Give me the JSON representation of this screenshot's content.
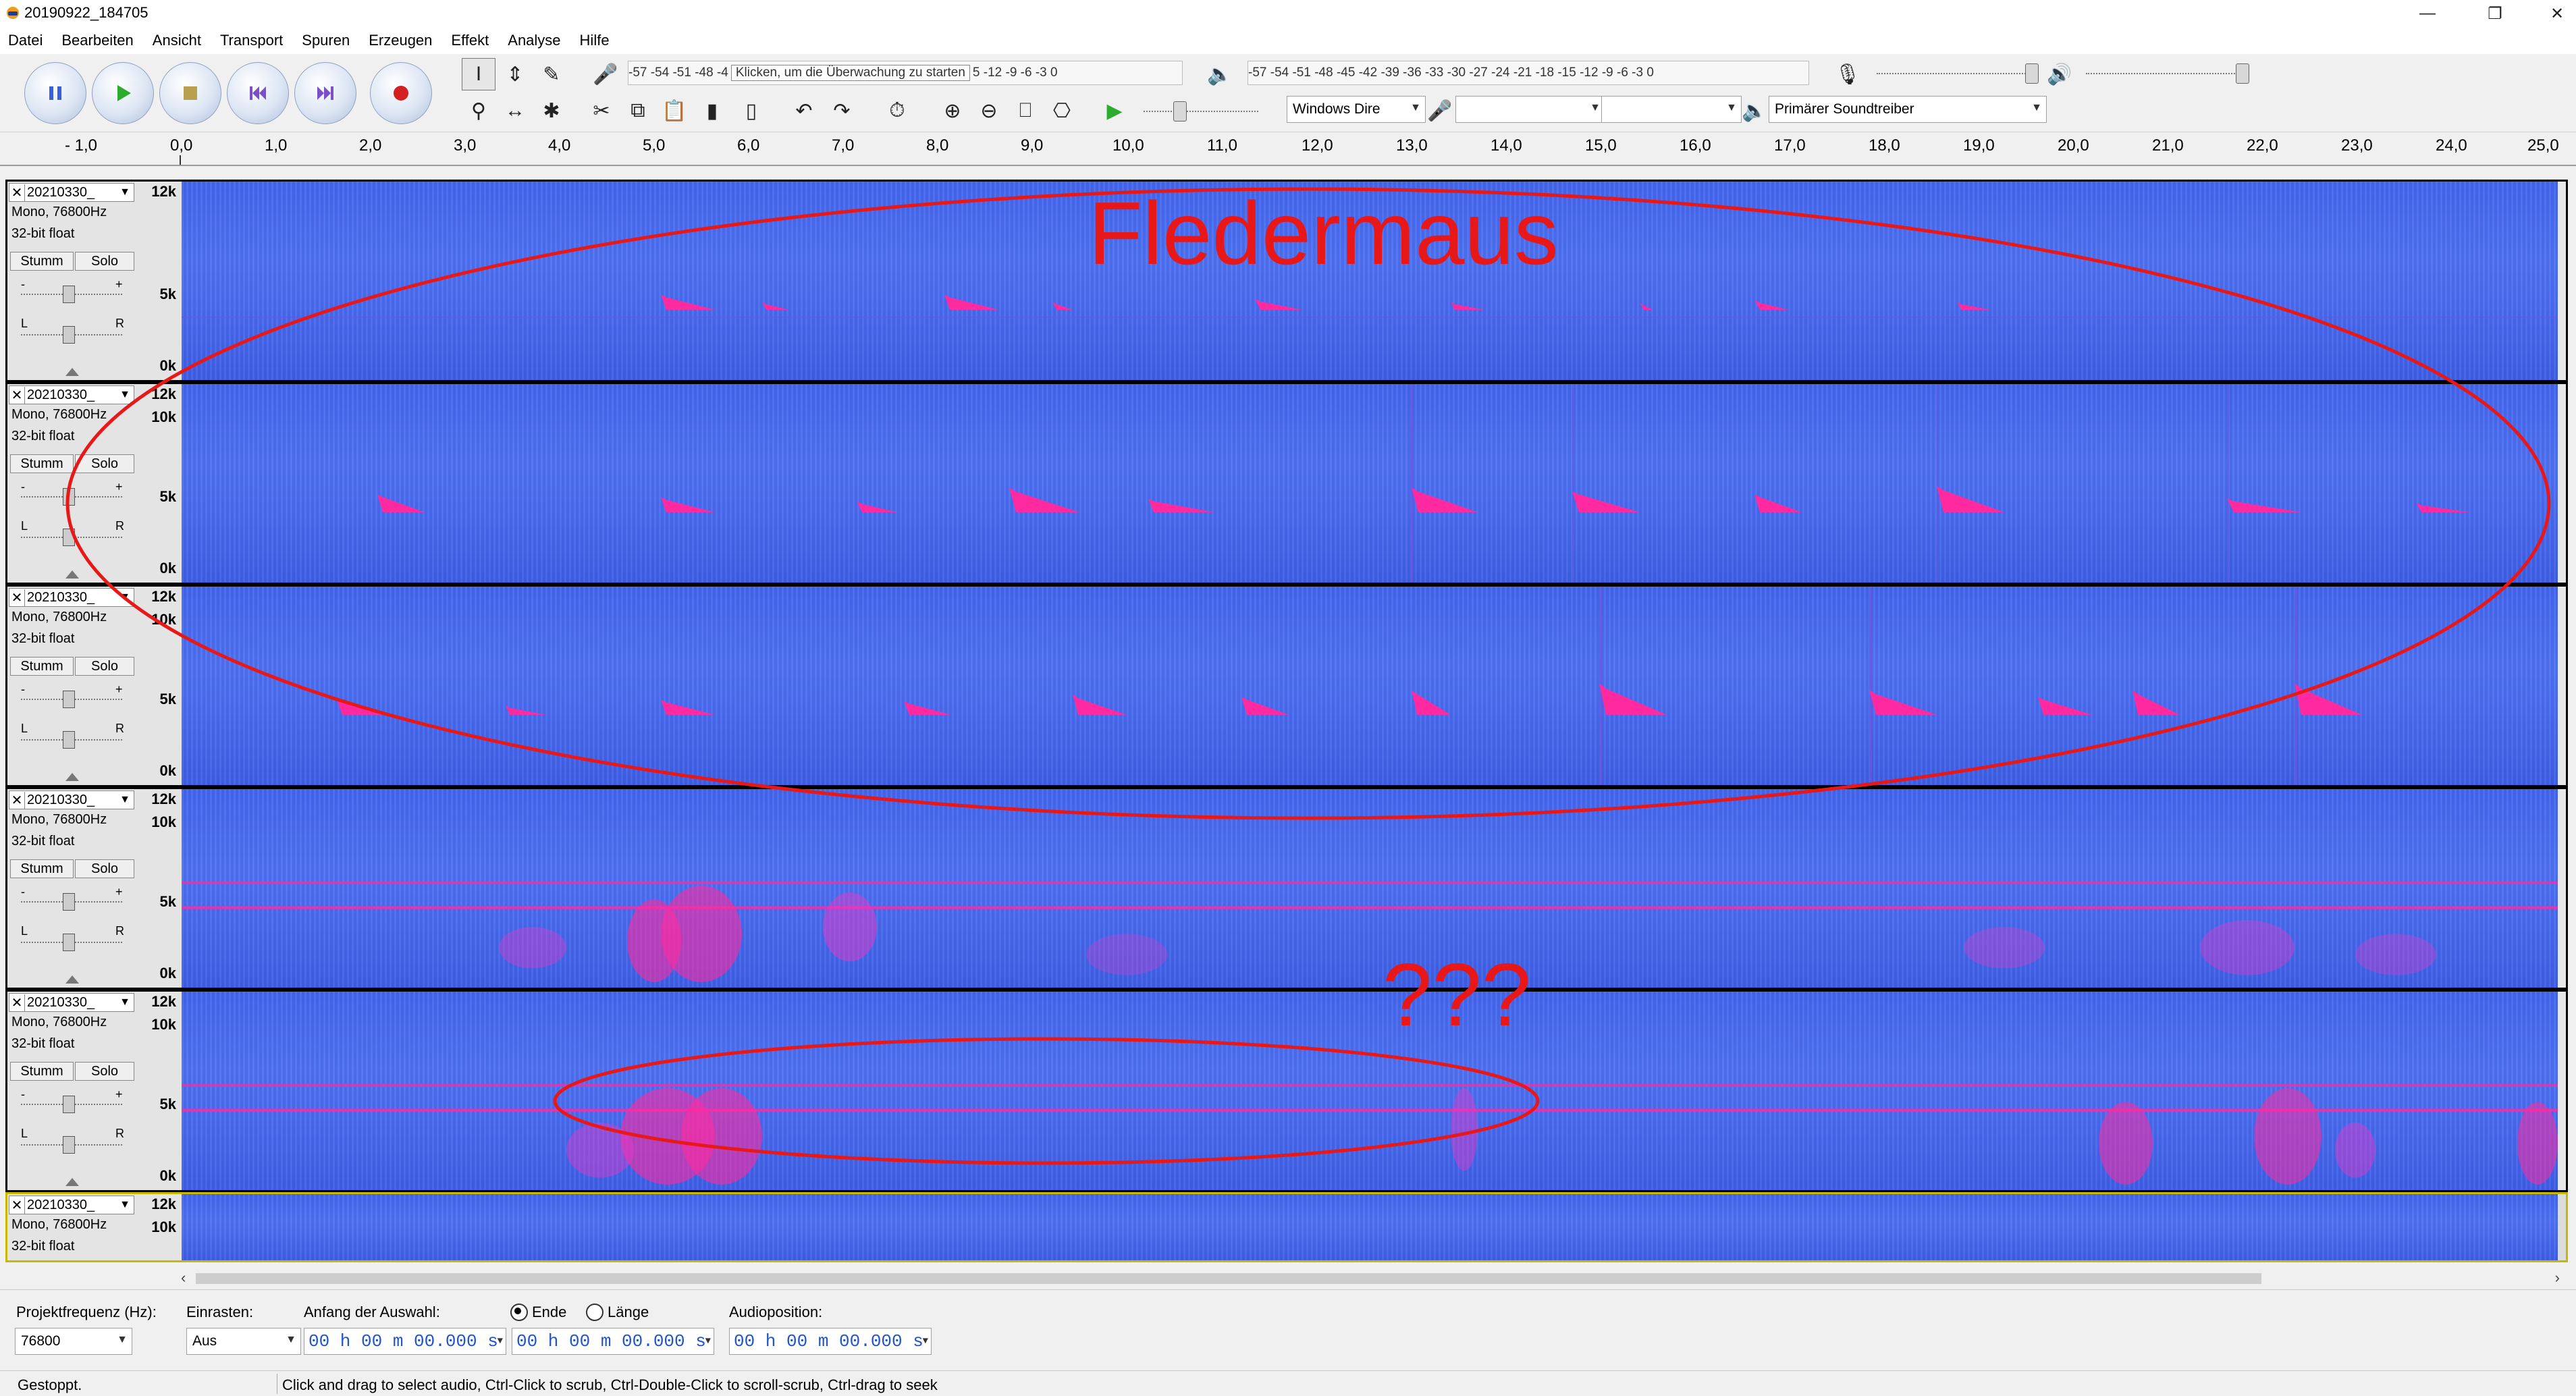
{
  "window": {
    "title": "20190922_184705"
  },
  "menu": [
    "Datei",
    "Bearbeiten",
    "Ansicht",
    "Transport",
    "Spuren",
    "Erzeugen",
    "Effekt",
    "Analyse",
    "Hilfe"
  ],
  "meters": {
    "record_scale": "-57 -54 -51 -48 -4",
    "monitor_hint": "Klicken, um die Überwachung zu starten",
    "record_scale_tail": "5 -12 -9 -6 -3 0",
    "playback_scale": "-57 -54 -51 -48 -45 -42 -39 -36 -33 -30 -27 -24 -21 -18 -15 -12 -9 -6 -3 0"
  },
  "devices": {
    "host": "Windows Dire",
    "recording_device": "",
    "channels": "",
    "playback_device": "Primärer Soundtreiber"
  },
  "ruler": {
    "ticks": [
      "- 1,0",
      "0,0",
      "1,0",
      "2,0",
      "3,0",
      "4,0",
      "5,0",
      "6,0",
      "7,0",
      "8,0",
      "9,0",
      "10,0",
      "11,0",
      "12,0",
      "13,0",
      "14,0",
      "15,0",
      "16,0",
      "17,0",
      "18,0",
      "19,0",
      "20,0",
      "21,0",
      "22,0",
      "23,0",
      "24,0",
      "25,0"
    ]
  },
  "track_common": {
    "name": "20210330_",
    "format": "Mono, 76800Hz",
    "bitdepth": "32-bit float",
    "mute_label": "Stumm",
    "solo_label": "Solo",
    "pan_left": "L",
    "pan_right": "R",
    "gain_minus": "-",
    "gain_plus": "+"
  },
  "freq_scale": {
    "top": "12k",
    "upper": "10k",
    "mid": "5k",
    "bottom": "0k"
  },
  "annotations": {
    "bat_label": "Fledermaus",
    "unknown_label": "???"
  },
  "selection_toolbar": {
    "rate_label": "Projektfrequenz (Hz):",
    "rate_value": "76800",
    "snap_label": "Einrasten:",
    "snap_value": "Aus",
    "start_label": "Anfang der Auswahl:",
    "end_radio": "Ende",
    "length_radio": "Länge",
    "start_time": "00 h 00 m 00.000 s",
    "end_time": "00 h 00 m 00.000 s",
    "audio_pos_label": "Audioposition:",
    "audio_pos_time": "00 h 00 m 00.000 s"
  },
  "status": {
    "state": "Gestoppt.",
    "hint": "Click and drag to select audio, Ctrl-Click to scrub, Ctrl-Double-Click to scroll-scrub, Ctrl-drag to seek"
  },
  "colors": {
    "spectrogram_bg": "#4a6cf0",
    "call": "#ff1493",
    "annotation": "#e81818",
    "accent_blue": "#2255cc"
  }
}
